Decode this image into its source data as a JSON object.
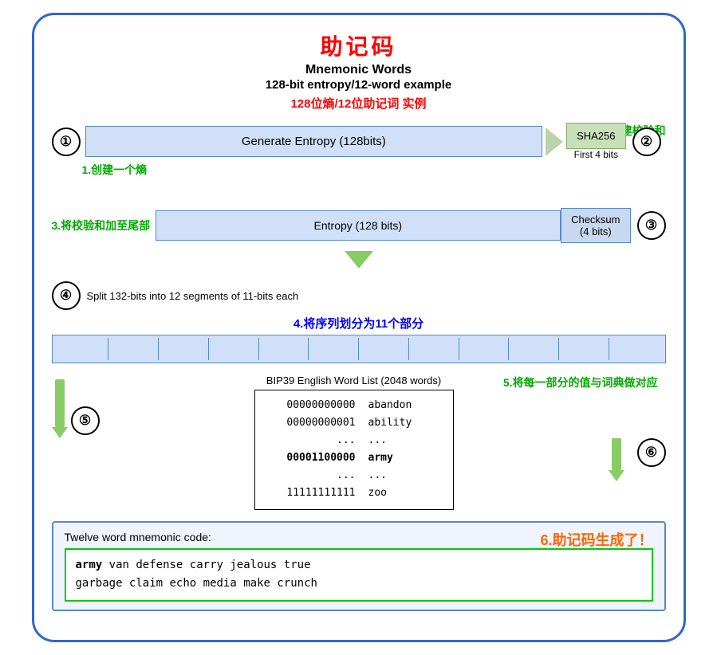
{
  "title": {
    "cn": "助记码",
    "en1": "Mnemonic Words",
    "en2": "128-bit entropy/12-word example",
    "cn2": "128位熵/12位助记词 实例"
  },
  "step2_label": "2.创建校验和",
  "step1_label": "1.创建一个熵",
  "step3_label": "3.将校验和加至尾部",
  "step4_label": "4.将序列划分为11个部分",
  "step5_label": "5.将每一部分的值与词典做对应",
  "step6_label": "6.助记码生成了！",
  "entropy_label": "Generate Entropy (128bits)",
  "sha_label": "SHA256",
  "first4bits": "First 4 bits",
  "entropy128_label": "Entropy (128 bits)",
  "checksum_label": "Checksum\n(4 bits)",
  "split_text": "Split 132-bits into 12 segments of 11-bits each",
  "bip39_title": "BIP39 English Word List (2048 words)",
  "bip39_rows": [
    {
      "bits": "00000000000",
      "word": "abandon"
    },
    {
      "bits": "00000000001",
      "word": "ability"
    },
    {
      "bits": "...",
      "word": "..."
    },
    {
      "bits": "00001100000",
      "word": "army",
      "highlight": true
    },
    {
      "bits": "...",
      "word": "..."
    },
    {
      "bits": "11111111111",
      "word": "zoo"
    }
  ],
  "result_label": "Twelve word mnemonic code:",
  "mnemonic_line1": "army van defense carry jealous true",
  "mnemonic_line2": "garbage claim echo media make crunch",
  "mnemonic_bold": "army",
  "steps": [
    "①",
    "②",
    "③",
    "④",
    "⑤",
    "⑥"
  ]
}
